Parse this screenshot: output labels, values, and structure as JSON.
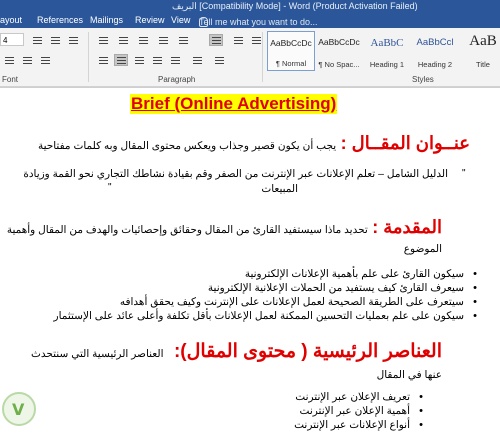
{
  "titlebar": {
    "title": "البريف [Compatibility Mode] - Word (Product Activation Failed)"
  },
  "tabs": [
    "ayout",
    "References",
    "Mailings",
    "Review",
    "View",
    "Tell me what you want to do..."
  ],
  "ribbon": {
    "font_size": "4",
    "group_font": "Font",
    "group_paragraph": "Paragraph",
    "group_styles": "Styles",
    "styles": [
      {
        "preview": "AaBbCcDc",
        "name": "¶ Normal"
      },
      {
        "preview": "AaBbCcDc",
        "name": "¶ No Spac..."
      },
      {
        "preview": "AaBbC",
        "name": "Heading 1"
      },
      {
        "preview": "AaBbCcl",
        "name": "Heading 2"
      },
      {
        "preview": "AaB",
        "name": "Title"
      }
    ]
  },
  "document": {
    "title": "Brief (Online Advertising)",
    "section1_heading": "عنــوان المقــال :",
    "section1_text": "يجب أن يكون قصير وجذاب ويعكس محتوى المقال وبه كلمات مفتاحية",
    "quote_line1": "الدليل الشامل – تعلم الإعلانات عبر الإنترنت من الصفر وقم بقيادة نشاطك التجاري نحو القمة وزيادة",
    "quote_line2": "المبيعات",
    "section2_heading": "المقدمة :",
    "section2_text": "تحديد ماذا سيستفيد القارئ من المقال وحقائق وإحصائيات والهدف من المقال وأهمية",
    "section2_text2": "الموضوع",
    "bullets1": [
      "سيكون القارئ على علم بأهمية الإعلانات الإلكترونية",
      "سيعرف القارئ كيف يستفيد من الحملات الإعلانية الإلكترونية",
      "سيتعرف على الطريقة الصحيحة لعمل الإعلانات على الإنترنت وكيف يحقق أهدافه",
      "سيكون على علم بعمليات التحسين الممكنة لعمل الإعلانات بأقل تكلفة وأعلى عائد على الإستثمار"
    ],
    "section3_heading": "العناصر الرئيسية ( محتوى المقال):",
    "section3_text": "العناصر الرئيسية التي سنتحدث",
    "section3_text2": "عنها في المقال",
    "bullets2": [
      "تعريف الإعلان عبر الإنترنت",
      "أهمية الإعلان عبر الإنترنت",
      "أنواع الإعلانات عبر الإنترنت"
    ]
  }
}
